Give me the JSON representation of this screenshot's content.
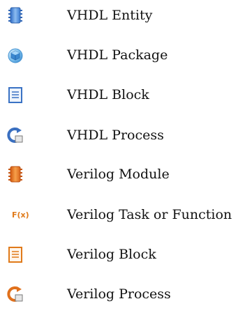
{
  "legend": {
    "items": [
      {
        "label": "VHDL Entity",
        "icon": "vhdl-entity-chip-icon",
        "color": "#4a86d8"
      },
      {
        "label": "VHDL Package",
        "icon": "vhdl-package-cube-icon",
        "color": "#5aaee0"
      },
      {
        "label": "VHDL Block",
        "icon": "vhdl-block-document-icon",
        "color": "#3a72c4"
      },
      {
        "label": "VHDL Process",
        "icon": "vhdl-process-arrow-icon",
        "color": "#3a6fc0"
      },
      {
        "label": "Verilog Module",
        "icon": "verilog-module-chip-icon",
        "color": "#e0701c"
      },
      {
        "label": "Verilog Task or Function",
        "icon": "verilog-function-fx-icon",
        "color": "#e07a1a",
        "glyph": "F(x)"
      },
      {
        "label": "Verilog Block",
        "icon": "verilog-block-document-icon",
        "color": "#e07a1a"
      },
      {
        "label": "Verilog Process",
        "icon": "verilog-process-arrow-icon",
        "color": "#e0701c"
      }
    ]
  }
}
